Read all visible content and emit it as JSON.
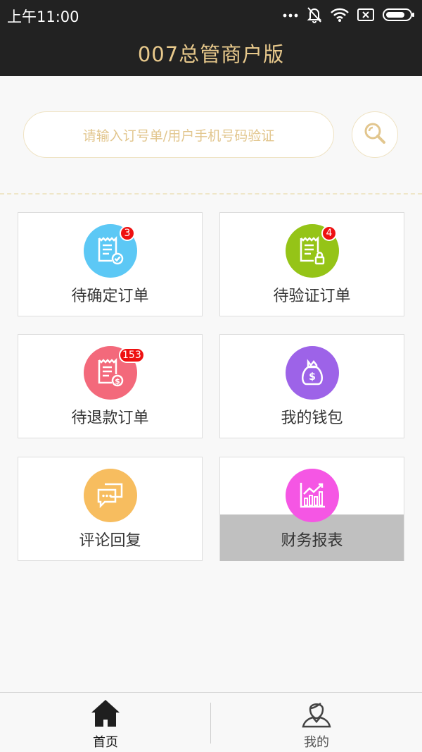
{
  "status_bar": {
    "time": "上午11:00",
    "icons": [
      "more-dots-icon",
      "bell-off-icon",
      "wifi-icon",
      "sim-off-icon",
      "battery-icon"
    ]
  },
  "header": {
    "title": "007总管商户版",
    "background": "#222222",
    "title_color": "#e8c98c"
  },
  "search": {
    "placeholder": "请输入订号单/用户手机号码验证",
    "button_icon": "search-icon"
  },
  "cards": [
    {
      "label": "待确定订单",
      "icon": "receipt-check-icon",
      "color": "#5cc8f5",
      "badge": "3"
    },
    {
      "label": "待验证订单",
      "icon": "receipt-lock-icon",
      "color": "#95c417",
      "badge": "4"
    },
    {
      "label": "待退款订单",
      "icon": "receipt-refund-icon",
      "color": "#f3697b",
      "badge": "153"
    },
    {
      "label": "我的钱包",
      "icon": "money-bag-icon",
      "color": "#9d63e8",
      "badge": ""
    },
    {
      "label": "评论回复",
      "icon": "chat-bubbles-icon",
      "color": "#f7bd5f",
      "badge": ""
    },
    {
      "label": "财务报表",
      "icon": "bar-chart-icon",
      "color": "#f556e4",
      "badge": "",
      "pressed": true
    }
  ],
  "tabbar": {
    "tabs": [
      {
        "label": "首页",
        "icon": "home-icon",
        "active": true
      },
      {
        "label": "我的",
        "icon": "person-icon",
        "active": false
      }
    ]
  }
}
